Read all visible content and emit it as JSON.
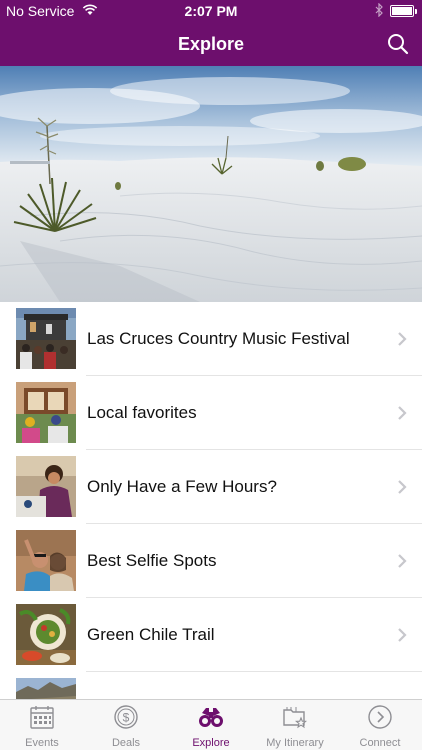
{
  "status_bar": {
    "carrier": "No Service",
    "time": "2:07 PM"
  },
  "nav": {
    "title": "Explore",
    "search_icon": "search-icon"
  },
  "colors": {
    "brand": "#6d0f6d",
    "tab_inactive": "#8e8e93",
    "chevron": "#c7c7cc"
  },
  "list": [
    {
      "label": "Las Cruces Country Music Festival",
      "image": "festival-stage-photo"
    },
    {
      "label": "Local favorites",
      "image": "restaurant-patio-photo"
    },
    {
      "label": "Only Have a Few Hours?",
      "image": "market-shopper-photo"
    },
    {
      "label": "Best Selfie Spots",
      "image": "couple-selfie-photo"
    },
    {
      "label": "Green Chile Trail",
      "image": "green-chile-dish-photo"
    },
    {
      "label": "",
      "image": "mountain-landscape-photo"
    }
  ],
  "tabs": [
    {
      "label": "Events",
      "icon": "calendar-icon"
    },
    {
      "label": "Deals",
      "icon": "dollar-coin-icon"
    },
    {
      "label": "Explore",
      "icon": "binoculars-icon",
      "active": true
    },
    {
      "label": "My Itinerary",
      "icon": "folder-star-icon"
    },
    {
      "label": "Connect",
      "icon": "arrow-circle-icon"
    }
  ]
}
